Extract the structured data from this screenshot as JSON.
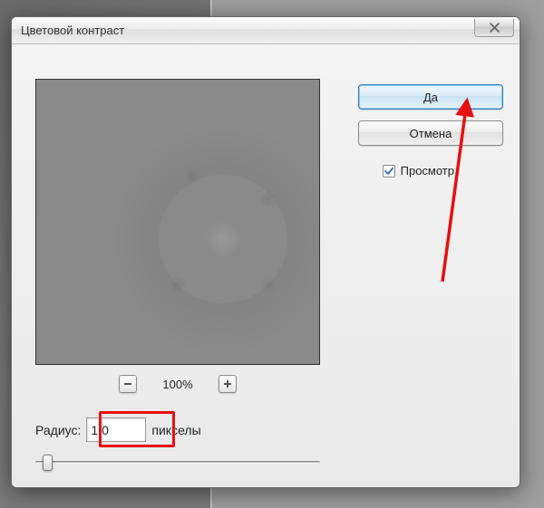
{
  "dialog": {
    "title": "Цветовой контраст"
  },
  "buttons": {
    "ok": "Да",
    "cancel": "Отмена"
  },
  "preview_checkbox": {
    "label": "Просмотр",
    "checked": true
  },
  "zoom": {
    "level": "100%"
  },
  "radius": {
    "label": "Радиус:",
    "value": "1,0",
    "unit": "пикселы"
  },
  "annotation": {
    "arrow_color": "#e80f0f",
    "highlight_color": "#e80f0f"
  }
}
